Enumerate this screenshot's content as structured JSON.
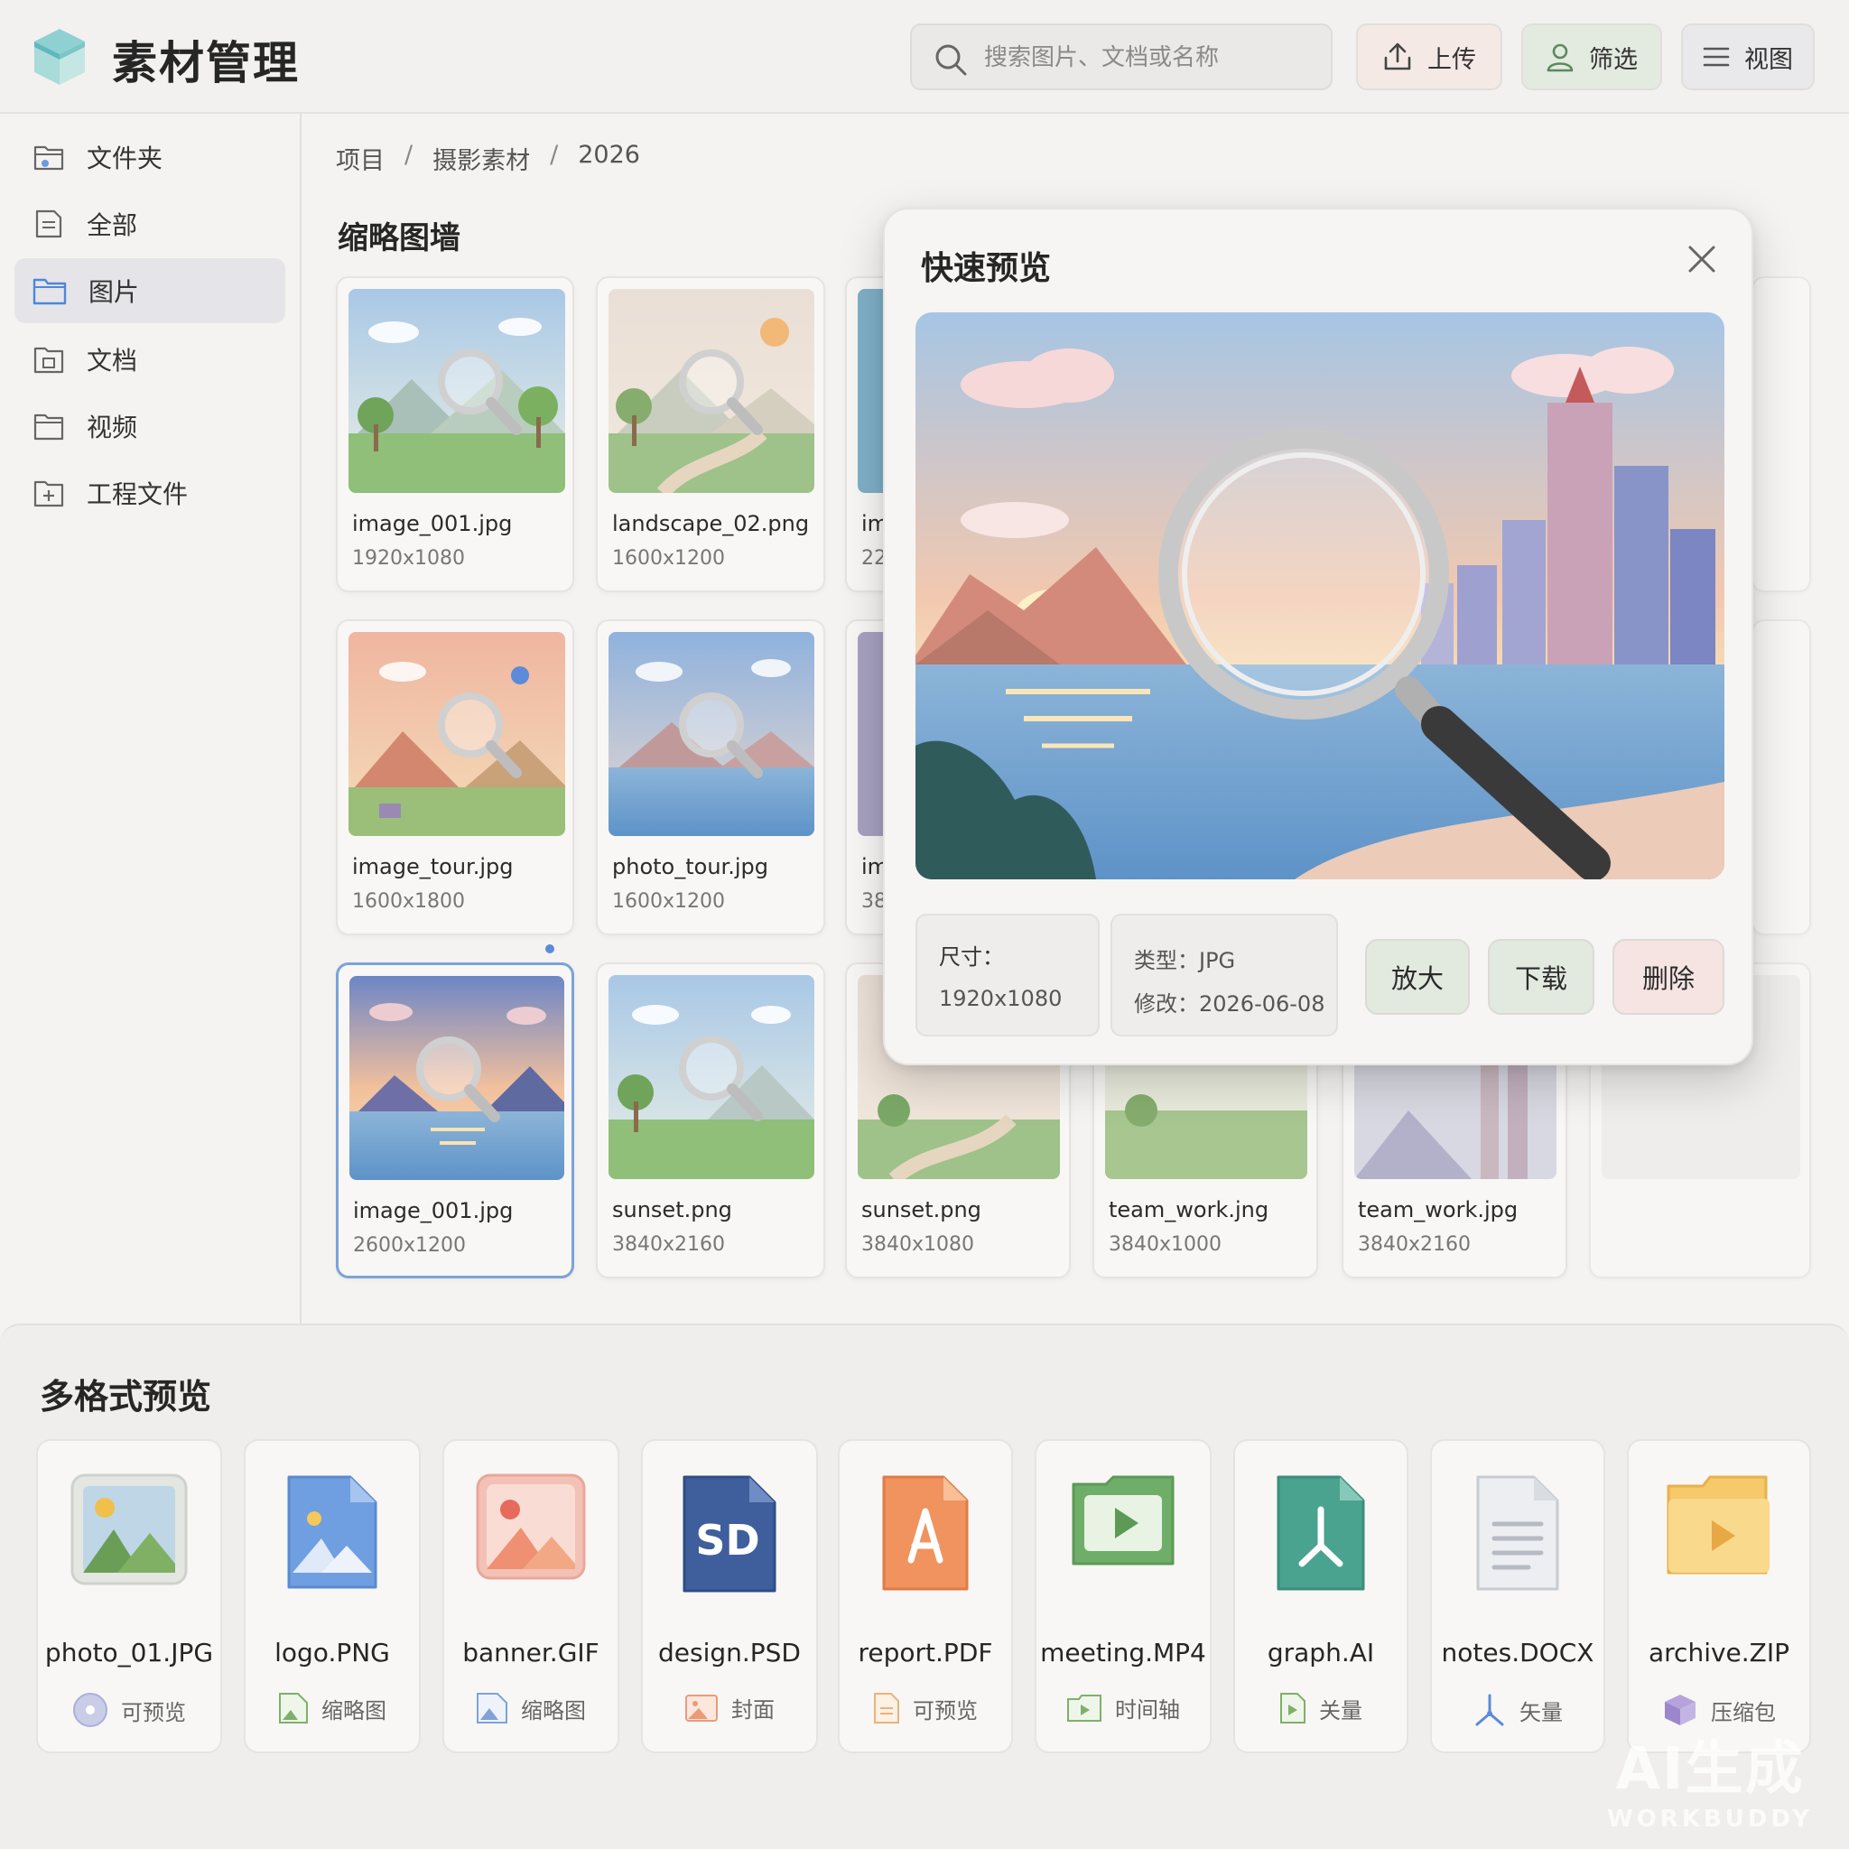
{
  "header": {
    "app_title": "素材管理",
    "search_placeholder": "搜索图片、文档或名称",
    "upload_label": "上传",
    "filter_label": "筛选",
    "view_label": "视图"
  },
  "sidebar": {
    "items": [
      {
        "label": "文件夹",
        "icon": "folder-tree-icon"
      },
      {
        "label": "全部",
        "icon": "all-files-icon"
      },
      {
        "label": "图片",
        "icon": "folder-icon",
        "active": true
      },
      {
        "label": "文档",
        "icon": "document-icon"
      },
      {
        "label": "视频",
        "icon": "video-folder-icon"
      },
      {
        "label": "工程文件",
        "icon": "project-file-icon"
      }
    ]
  },
  "breadcrumb": [
    "项目",
    "/",
    "摄影素材",
    "/",
    "2026"
  ],
  "gallery": {
    "title": "缩略图墙",
    "items": [
      {
        "name": "image_001.jpg",
        "size": "1920x1080"
      },
      {
        "name": "landscape_02.png",
        "size": "1600x1200"
      },
      {
        "name": "im",
        "size": "22"
      },
      {
        "name": "image_tour.jpg",
        "size": "1600x1800"
      },
      {
        "name": "photo_tour.jpg",
        "size": "1600x1200"
      },
      {
        "name": "im",
        "size": "38"
      },
      {
        "name": "image_001.jpg",
        "size": "2600x1200",
        "selected": true
      },
      {
        "name": "sunset.png",
        "size": "3840x2160"
      },
      {
        "name": "sunset.png",
        "size": "3840x1080"
      },
      {
        "name": "team_work.jng",
        "size": "3840x1000"
      },
      {
        "name": "team_work.jpg",
        "size": "3840x2160"
      }
    ]
  },
  "preview": {
    "title": "快速预览",
    "size_label": "尺寸：",
    "size_value": "1920x1080",
    "type_line": "类型：JPG",
    "modified_line": "修改：2026-06-08",
    "zoom_label": "放大",
    "download_label": "下载",
    "delete_label": "删除"
  },
  "formats": {
    "title": "多格式预览",
    "items": [
      {
        "name": "photo_01.JPG",
        "tag": "可预览",
        "icon": "image-file-icon",
        "tag_icon": "disc-icon"
      },
      {
        "name": "logo.PNG",
        "tag": "缩略图",
        "icon": "png-file-icon",
        "tag_icon": "image-small-icon"
      },
      {
        "name": "banner.GIF",
        "tag": "缩略图",
        "icon": "gif-file-icon",
        "tag_icon": "image-small-icon"
      },
      {
        "name": "design.PSD",
        "tag": "封面",
        "icon": "psd-file-icon",
        "tag_icon": "image-small-icon",
        "badge": "SD"
      },
      {
        "name": "report.PDF",
        "tag": "可预览",
        "icon": "pdf-file-icon",
        "tag_icon": "doc-small-icon"
      },
      {
        "name": "meeting.MP4",
        "tag": "时间轴",
        "icon": "video-file-icon",
        "tag_icon": "play-folder-icon"
      },
      {
        "name": "graph.AI",
        "tag": "关量",
        "icon": "ai-file-icon",
        "tag_icon": "play-doc-icon"
      },
      {
        "name": "notes.DOCX",
        "tag": "矢量",
        "icon": "docx-file-icon",
        "tag_icon": "vector-icon"
      },
      {
        "name": "archive.ZIP",
        "tag": "压缩包",
        "icon": "zip-folder-icon",
        "tag_icon": "box-icon"
      }
    ]
  },
  "watermark": {
    "line1": "AI生成",
    "line2": "WORKBUDDY"
  },
  "colors": {
    "accent_blue": "#7aa3db",
    "upload_bg": "#f5e9e6",
    "filter_bg": "#e3ebe0",
    "delete_bg": "#f6e4e3"
  }
}
